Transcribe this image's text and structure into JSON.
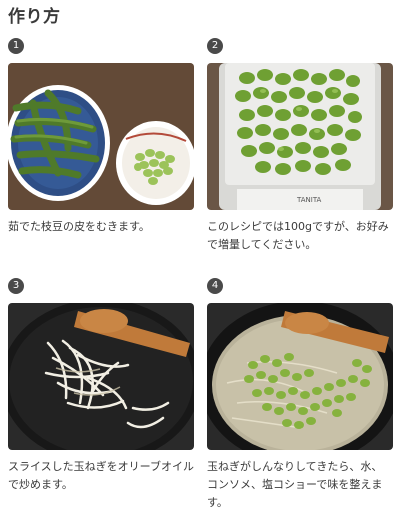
{
  "section": {
    "title": "作り方"
  },
  "steps": [
    {
      "number": "1",
      "text": "茹でた枝豆の皮をむきます。"
    },
    {
      "number": "2",
      "text": "このレシピでは100gですが、お好みで増量してください。"
    },
    {
      "number": "3",
      "text": "スライスした玉ねぎをオリーブオイルで炒めます。"
    },
    {
      "number": "4",
      "text": "玉ねぎがしんなりしてきたら、水、コンソメ、塩コショーで味を整えます。"
    }
  ],
  "scale_brand": "TANITA",
  "colors": {
    "badge": "#4a4a4a",
    "bean": "#7fae3a",
    "pan": "#1c1c1c"
  }
}
